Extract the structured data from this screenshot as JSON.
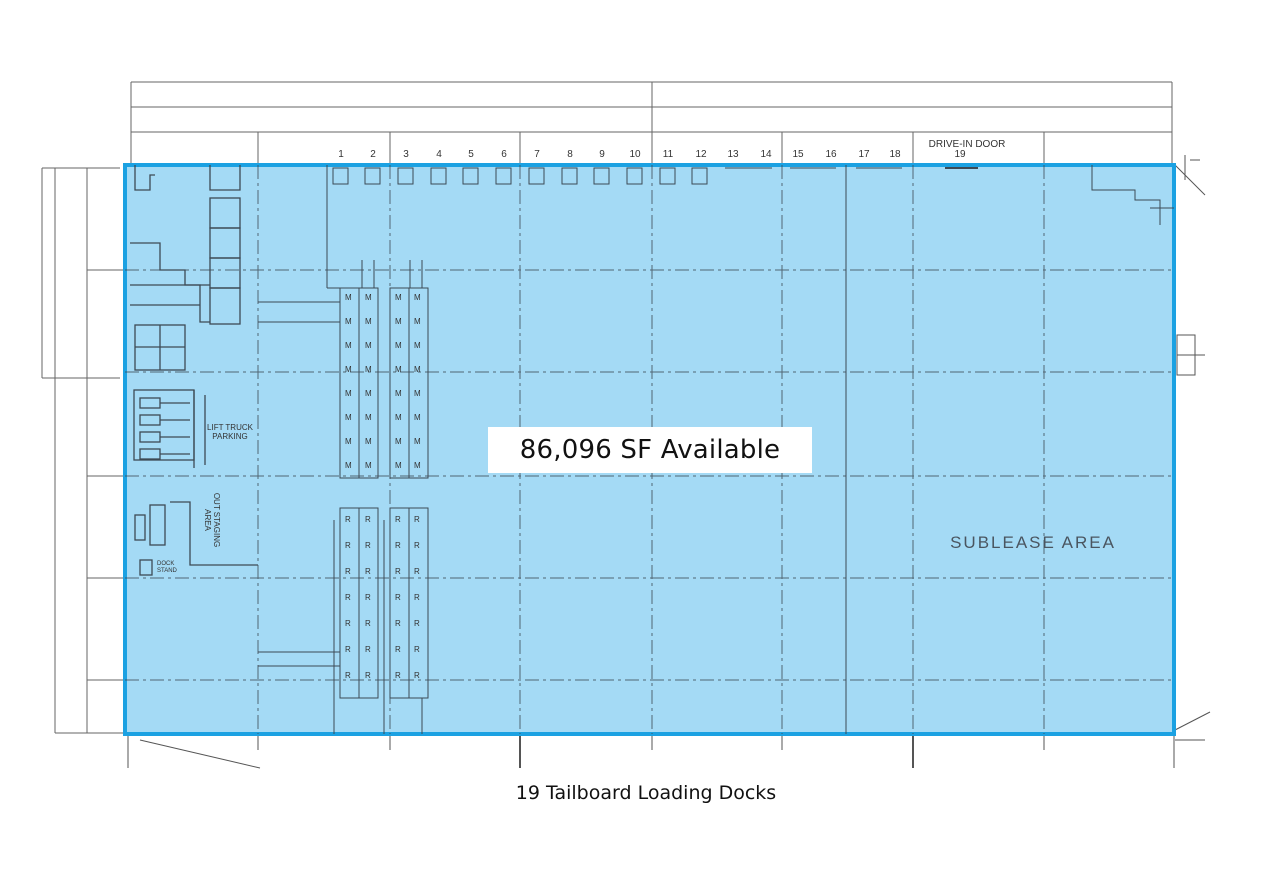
{
  "plan": {
    "dock_numbers": [
      "1",
      "2",
      "3",
      "4",
      "5",
      "6",
      "7",
      "8",
      "9",
      "10",
      "11",
      "12",
      "13",
      "14",
      "15",
      "16",
      "17",
      "18"
    ],
    "drive_in_door_label": "DRIVE-IN DOOR",
    "drive_in_door_number": "19",
    "available_label": "86,096 SF Available",
    "sublease_label": "SUBLEASE AREA",
    "lift_truck_label_1": "LIFT TRUCK",
    "lift_truck_label_2": "PARKING",
    "staging_label_1": "OUT STAGING",
    "staging_label_2": "AREA",
    "dock_stand_label_1": "DOCK",
    "dock_stand_label_2": "STAND",
    "rack_mark_upper": "M",
    "rack_mark_lower": "R",
    "highlight_color": "#a4daf5",
    "outline_color": "#1ba1e2"
  },
  "caption": "19 Tailboard Loading Docks"
}
